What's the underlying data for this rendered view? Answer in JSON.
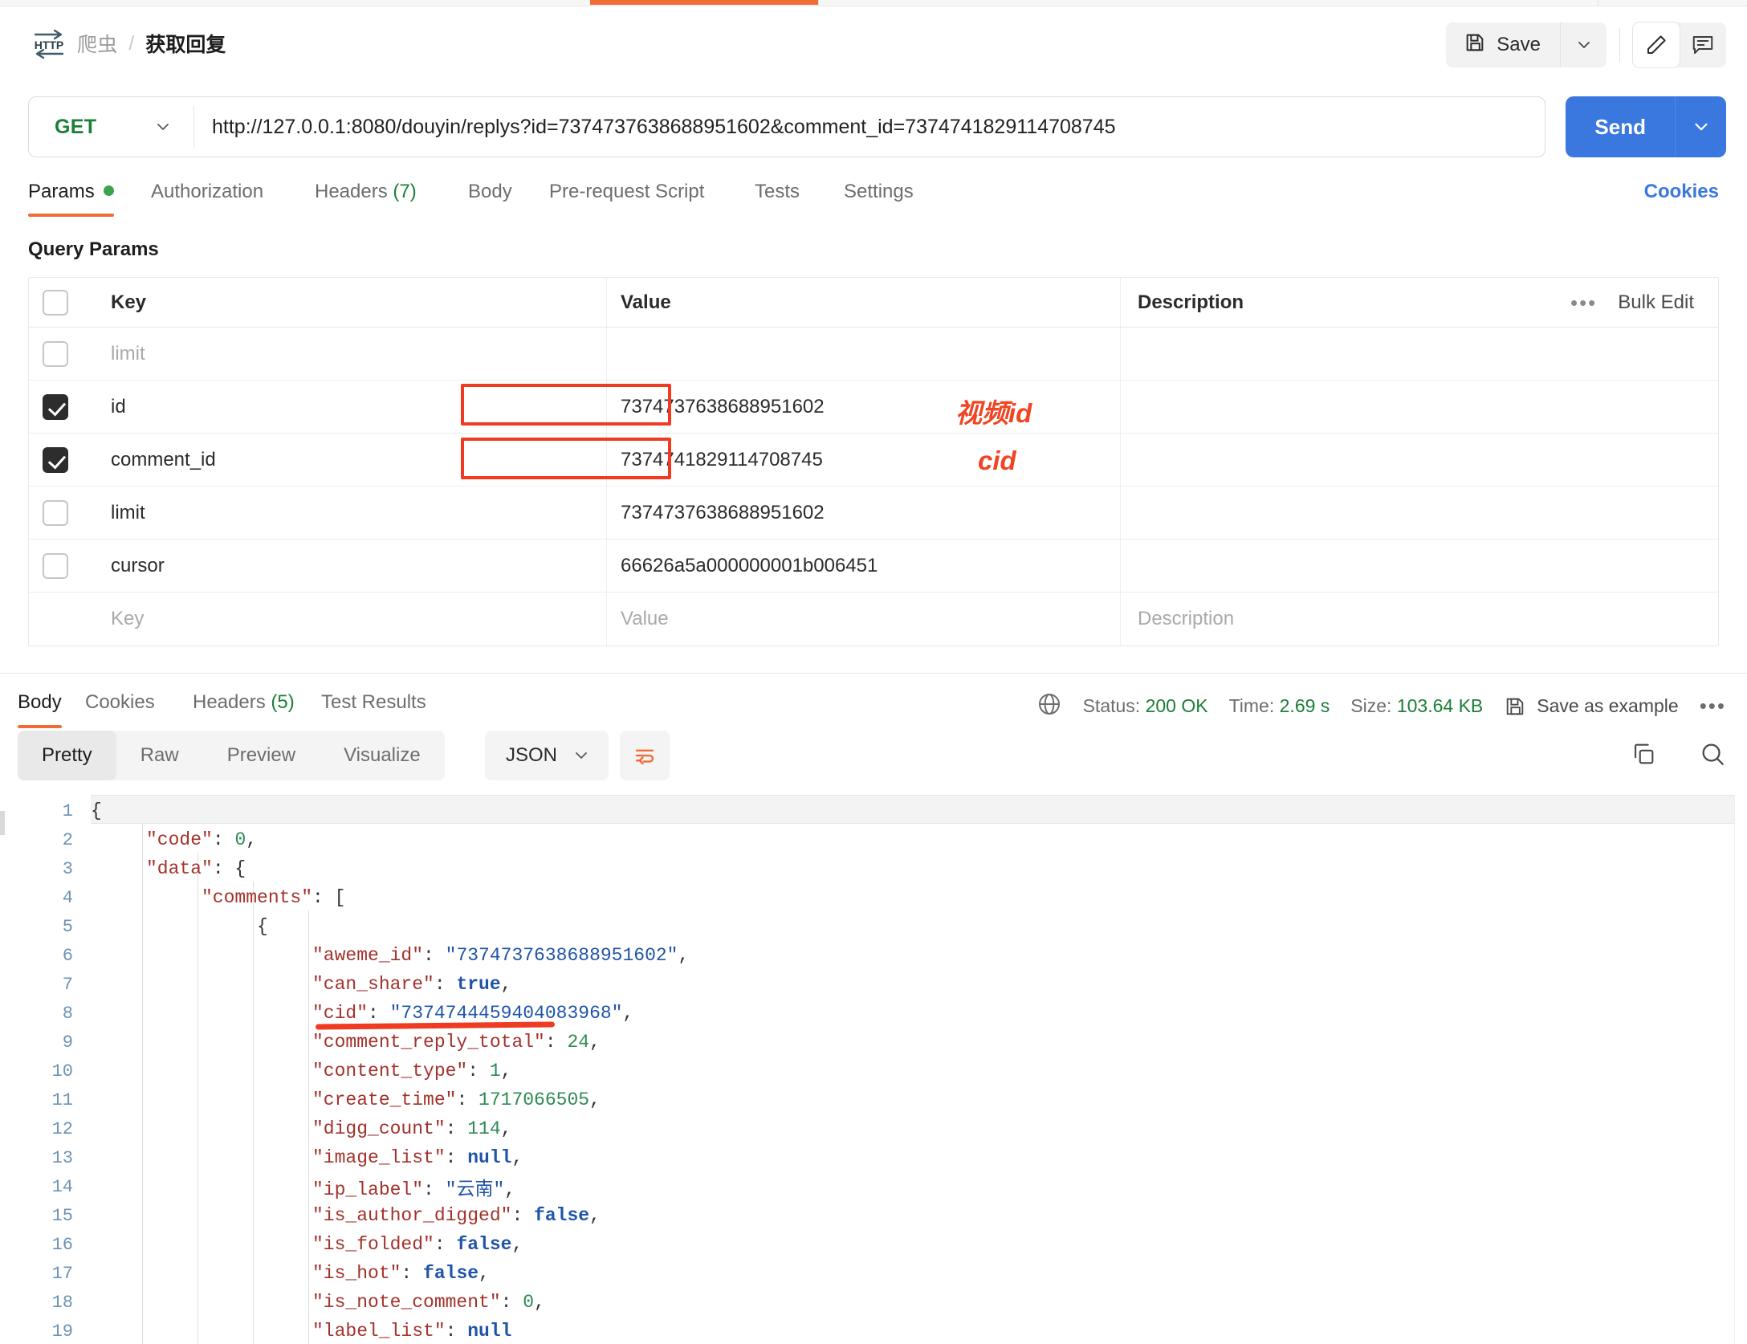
{
  "header": {
    "icon_label": "HTTP",
    "breadcrumb_parent": "爬虫",
    "breadcrumb_sep": "/",
    "breadcrumb_current": "获取回复",
    "save_label": "Save"
  },
  "url_bar": {
    "method": "GET",
    "url": "http://127.0.0.1:8080/douyin/replys?id=7374737638688951602&comment_id=7374741829114708745",
    "send_label": "Send"
  },
  "request_tabs": [
    {
      "label": "Params",
      "active": true,
      "dot": true
    },
    {
      "label": "Authorization",
      "active": false
    },
    {
      "label": "Headers",
      "count": "(7)",
      "active": false
    },
    {
      "label": "Body",
      "active": false
    },
    {
      "label": "Pre-request Script",
      "active": false
    },
    {
      "label": "Tests",
      "active": false
    },
    {
      "label": "Settings",
      "active": false
    }
  ],
  "cookies_link": "Cookies",
  "query_params": {
    "section_title": "Query Params",
    "columns": {
      "key": "Key",
      "value": "Value",
      "description": "Description"
    },
    "bulk_edit": "Bulk Edit",
    "rows": [
      {
        "checked": false,
        "key": "limit",
        "key_muted": true,
        "value": "",
        "description": ""
      },
      {
        "checked": true,
        "key": "id",
        "key_muted": false,
        "value": "7374737638688951602",
        "description": "",
        "highlight": true,
        "annotation": "视频id"
      },
      {
        "checked": true,
        "key": "comment_id",
        "key_muted": false,
        "value": "7374741829114708745",
        "description": "",
        "highlight": true,
        "annotation": "cid"
      },
      {
        "checked": false,
        "key": "limit",
        "key_muted": false,
        "value": "7374737638688951602",
        "description": ""
      },
      {
        "checked": false,
        "key": "cursor",
        "key_muted": false,
        "value": "66626a5a000000001b006451",
        "description": ""
      },
      {
        "checked": null,
        "key": "Key",
        "key_muted": true,
        "value": "Value",
        "value_muted": true,
        "description": "Description",
        "desc_muted": true
      }
    ]
  },
  "response": {
    "tabs": [
      {
        "label": "Body",
        "active": true
      },
      {
        "label": "Cookies",
        "active": false
      },
      {
        "label": "Headers",
        "count": "(5)",
        "active": false
      },
      {
        "label": "Test Results",
        "active": false
      }
    ],
    "status_label": "Status:",
    "status_value": "200 OK",
    "time_label": "Time:",
    "time_value": "2.69 s",
    "size_label": "Size:",
    "size_value": "103.64 KB",
    "save_example": "Save as example",
    "view_modes": [
      "Pretty",
      "Raw",
      "Preview",
      "Visualize"
    ],
    "active_view": "Pretty",
    "format": "JSON"
  },
  "body_lines": [
    {
      "n": "1",
      "indent": 0,
      "tokens": [
        {
          "t": "{",
          "c": "p"
        }
      ]
    },
    {
      "n": "2",
      "indent": 1,
      "tokens": [
        {
          "t": "\"code\"",
          "c": "k"
        },
        {
          "t": ": ",
          "c": "p"
        },
        {
          "t": "0",
          "c": "n"
        },
        {
          "t": ",",
          "c": "p"
        }
      ]
    },
    {
      "n": "3",
      "indent": 1,
      "tokens": [
        {
          "t": "\"data\"",
          "c": "k"
        },
        {
          "t": ": {",
          "c": "p"
        }
      ]
    },
    {
      "n": "4",
      "indent": 2,
      "tokens": [
        {
          "t": "\"comments\"",
          "c": "k"
        },
        {
          "t": ": [",
          "c": "p"
        }
      ]
    },
    {
      "n": "5",
      "indent": 3,
      "tokens": [
        {
          "t": "{",
          "c": "p"
        }
      ]
    },
    {
      "n": "6",
      "indent": 4,
      "tokens": [
        {
          "t": "\"aweme_id\"",
          "c": "k"
        },
        {
          "t": ": ",
          "c": "p"
        },
        {
          "t": "\"7374737638688951602\"",
          "c": "s"
        },
        {
          "t": ",",
          "c": "p"
        }
      ]
    },
    {
      "n": "7",
      "indent": 4,
      "tokens": [
        {
          "t": "\"can_share\"",
          "c": "k"
        },
        {
          "t": ": ",
          "c": "p"
        },
        {
          "t": "true",
          "c": "b"
        },
        {
          "t": ",",
          "c": "p"
        }
      ]
    },
    {
      "n": "8",
      "indent": 4,
      "tokens": [
        {
          "t": "\"cid\"",
          "c": "k"
        },
        {
          "t": ": ",
          "c": "p"
        },
        {
          "t": "\"7374744459404083968\"",
          "c": "s"
        },
        {
          "t": ",",
          "c": "p"
        }
      ],
      "annotated": true
    },
    {
      "n": "9",
      "indent": 4,
      "tokens": [
        {
          "t": "\"comment_reply_total\"",
          "c": "k"
        },
        {
          "t": ": ",
          "c": "p"
        },
        {
          "t": "24",
          "c": "n"
        },
        {
          "t": ",",
          "c": "p"
        }
      ]
    },
    {
      "n": "10",
      "indent": 4,
      "tokens": [
        {
          "t": "\"content_type\"",
          "c": "k"
        },
        {
          "t": ": ",
          "c": "p"
        },
        {
          "t": "1",
          "c": "n"
        },
        {
          "t": ",",
          "c": "p"
        }
      ]
    },
    {
      "n": "11",
      "indent": 4,
      "tokens": [
        {
          "t": "\"create_time\"",
          "c": "k"
        },
        {
          "t": ": ",
          "c": "p"
        },
        {
          "t": "1717066505",
          "c": "n"
        },
        {
          "t": ",",
          "c": "p"
        }
      ]
    },
    {
      "n": "12",
      "indent": 4,
      "tokens": [
        {
          "t": "\"digg_count\"",
          "c": "k"
        },
        {
          "t": ": ",
          "c": "p"
        },
        {
          "t": "114",
          "c": "n"
        },
        {
          "t": ",",
          "c": "p"
        }
      ]
    },
    {
      "n": "13",
      "indent": 4,
      "tokens": [
        {
          "t": "\"image_list\"",
          "c": "k"
        },
        {
          "t": ": ",
          "c": "p"
        },
        {
          "t": "null",
          "c": "b"
        },
        {
          "t": ",",
          "c": "p"
        }
      ]
    },
    {
      "n": "14",
      "indent": 4,
      "tokens": [
        {
          "t": "\"ip_label\"",
          "c": "k"
        },
        {
          "t": ": ",
          "c": "p"
        },
        {
          "t": "\"云南\"",
          "c": "s"
        },
        {
          "t": ",",
          "c": "p"
        }
      ]
    },
    {
      "n": "15",
      "indent": 4,
      "tokens": [
        {
          "t": "\"is_author_digged\"",
          "c": "k"
        },
        {
          "t": ": ",
          "c": "p"
        },
        {
          "t": "false",
          "c": "b"
        },
        {
          "t": ",",
          "c": "p"
        }
      ]
    },
    {
      "n": "16",
      "indent": 4,
      "tokens": [
        {
          "t": "\"is_folded\"",
          "c": "k"
        },
        {
          "t": ": ",
          "c": "p"
        },
        {
          "t": "false",
          "c": "b"
        },
        {
          "t": ",",
          "c": "p"
        }
      ]
    },
    {
      "n": "17",
      "indent": 4,
      "tokens": [
        {
          "t": "\"is_hot\"",
          "c": "k"
        },
        {
          "t": ": ",
          "c": "p"
        },
        {
          "t": "false",
          "c": "b"
        },
        {
          "t": ",",
          "c": "p"
        }
      ]
    },
    {
      "n": "18",
      "indent": 4,
      "tokens": [
        {
          "t": "\"is_note_comment\"",
          "c": "k"
        },
        {
          "t": ": ",
          "c": "p"
        },
        {
          "t": "0",
          "c": "n"
        },
        {
          "t": ",",
          "c": "p"
        }
      ]
    },
    {
      "n": "19",
      "indent": 4,
      "tokens": [
        {
          "t": "\"label_list\"",
          "c": "k"
        },
        {
          "t": ": ",
          "c": "p"
        },
        {
          "t": "null",
          "c": "b"
        }
      ]
    }
  ],
  "icons": {
    "http": "http-icon",
    "save": "floppy-disk-icon",
    "caret": "chevron-down-icon",
    "pencil": "pencil-icon",
    "comment": "comment-icon",
    "globe": "globe-icon",
    "copy": "copy-icon",
    "search": "search-icon",
    "wrap": "word-wrap-icon"
  },
  "colors": {
    "accent": "#ef6c37",
    "send": "#3a78df",
    "green": "#1a7f37",
    "annotation": "#ef3b22"
  }
}
